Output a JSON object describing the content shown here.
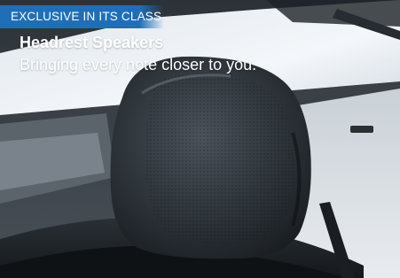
{
  "badge": {
    "label": "EXCLUSIVE IN ITS CLASS"
  },
  "feature": {
    "title": "Headrest Speakers",
    "subtitle": "Bringing every note closer to you."
  },
  "colors": {
    "badge_background": "#1f6fb8",
    "text": "#ffffff"
  },
  "icons": {
    "scene": "headrest-speaker-photo"
  }
}
